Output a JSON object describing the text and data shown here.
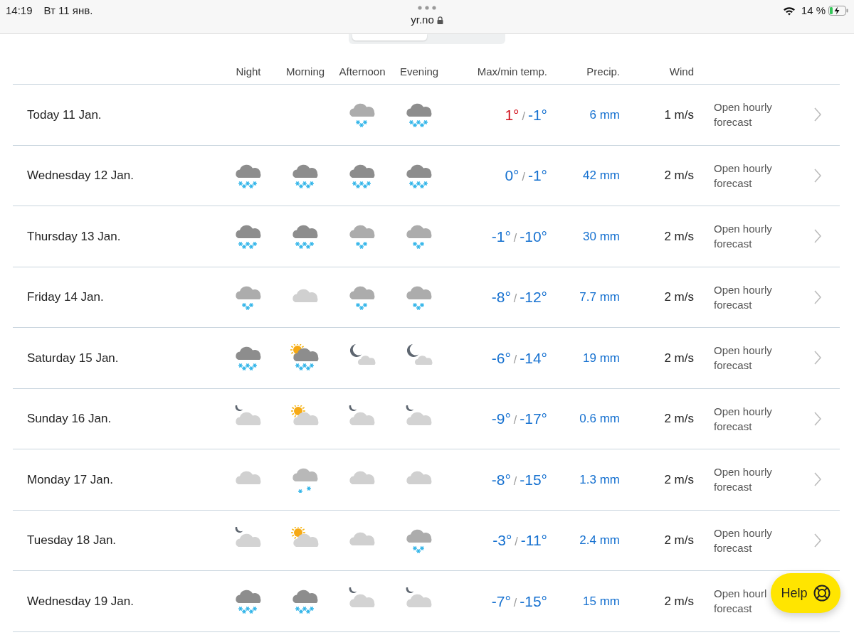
{
  "status_bar": {
    "time": "14:19",
    "date": "Вт 11 янв.",
    "url": "yr.no",
    "battery": "14 %"
  },
  "columns": [
    "Night",
    "Morning",
    "Afternoon",
    "Evening",
    "Max/min temp.",
    "Precip.",
    "Wind"
  ],
  "rows": [
    {
      "date": "Today 11 Jan.",
      "icons": [
        {
          "kind": "none"
        },
        {
          "kind": "none"
        },
        {
          "kind": "snow"
        },
        {
          "kind": "heavy_snow"
        }
      ],
      "max": "1°",
      "sep": "/",
      "min": "-1°",
      "max_warm": true,
      "precip": "6 mm",
      "wind": "1 m/s",
      "link": [
        "Open hourly",
        "forecast"
      ]
    },
    {
      "date": "Wednesday 12 Jan.",
      "icons": [
        {
          "kind": "heavy_snow"
        },
        {
          "kind": "heavy_snow"
        },
        {
          "kind": "heavy_snow"
        },
        {
          "kind": "heavy_snow"
        }
      ],
      "max": "0°",
      "sep": "/",
      "min": "-1°",
      "max_warm": false,
      "precip": "42 mm",
      "wind": "2 m/s",
      "link": [
        "Open hourly",
        "forecast"
      ]
    },
    {
      "date": "Thursday 13 Jan.",
      "icons": [
        {
          "kind": "heavy_snow"
        },
        {
          "kind": "heavy_snow"
        },
        {
          "kind": "snow"
        },
        {
          "kind": "snow"
        }
      ],
      "max": "-1°",
      "sep": "/",
      "min": "-10°",
      "max_warm": false,
      "precip": "30 mm",
      "wind": "2 m/s",
      "link": [
        "Open hourly",
        "forecast"
      ]
    },
    {
      "date": "Friday 14 Jan.",
      "icons": [
        {
          "kind": "snow"
        },
        {
          "kind": "cloudy"
        },
        {
          "kind": "snow"
        },
        {
          "kind": "snow"
        }
      ],
      "max": "-8°",
      "sep": "/",
      "min": "-12°",
      "max_warm": false,
      "precip": "7.7 mm",
      "wind": "2 m/s",
      "link": [
        "Open hourly",
        "forecast"
      ]
    },
    {
      "date": "Saturday 15 Jan.",
      "icons": [
        {
          "kind": "heavy_snow"
        },
        {
          "kind": "sun_snow"
        },
        {
          "kind": "fair_night"
        },
        {
          "kind": "fair_night"
        }
      ],
      "max": "-6°",
      "sep": "/",
      "min": "-14°",
      "max_warm": false,
      "precip": "19 mm",
      "wind": "2 m/s",
      "link": [
        "Open hourly",
        "forecast"
      ]
    },
    {
      "date": "Sunday 16 Jan.",
      "icons": [
        {
          "kind": "cloudy_night"
        },
        {
          "kind": "cloudy_day"
        },
        {
          "kind": "cloudy_night"
        },
        {
          "kind": "cloudy_night"
        }
      ],
      "max": "-9°",
      "sep": "/",
      "min": "-17°",
      "max_warm": false,
      "precip": "0.6 mm",
      "wind": "2 m/s",
      "link": [
        "Open hourly",
        "forecast"
      ]
    },
    {
      "date": "Monday 17 Jan.",
      "icons": [
        {
          "kind": "cloudy"
        },
        {
          "kind": "light_snow"
        },
        {
          "kind": "cloudy"
        },
        {
          "kind": "cloudy"
        }
      ],
      "max": "-8°",
      "sep": "/",
      "min": "-15°",
      "max_warm": false,
      "precip": "1.3 mm",
      "wind": "2 m/s",
      "link": [
        "Open hourly",
        "forecast"
      ]
    },
    {
      "date": "Tuesday 18 Jan.",
      "icons": [
        {
          "kind": "cloudy_night"
        },
        {
          "kind": "cloudy_day"
        },
        {
          "kind": "cloudy"
        },
        {
          "kind": "snow"
        }
      ],
      "max": "-3°",
      "sep": "/",
      "min": "-11°",
      "max_warm": false,
      "precip": "2.4 mm",
      "wind": "2 m/s",
      "link": [
        "Open hourly",
        "forecast"
      ]
    },
    {
      "date": "Wednesday 19 Jan.",
      "icons": [
        {
          "kind": "heavy_snow"
        },
        {
          "kind": "heavy_snow"
        },
        {
          "kind": "cloudy_night"
        },
        {
          "kind": "cloudy_night"
        }
      ],
      "max": "-7°",
      "sep": "/",
      "min": "-15°",
      "max_warm": false,
      "precip": "15 mm",
      "wind": "2 m/s",
      "link": [
        "Open hourl",
        "forecast"
      ]
    }
  ],
  "help_button": {
    "label": "Help"
  }
}
